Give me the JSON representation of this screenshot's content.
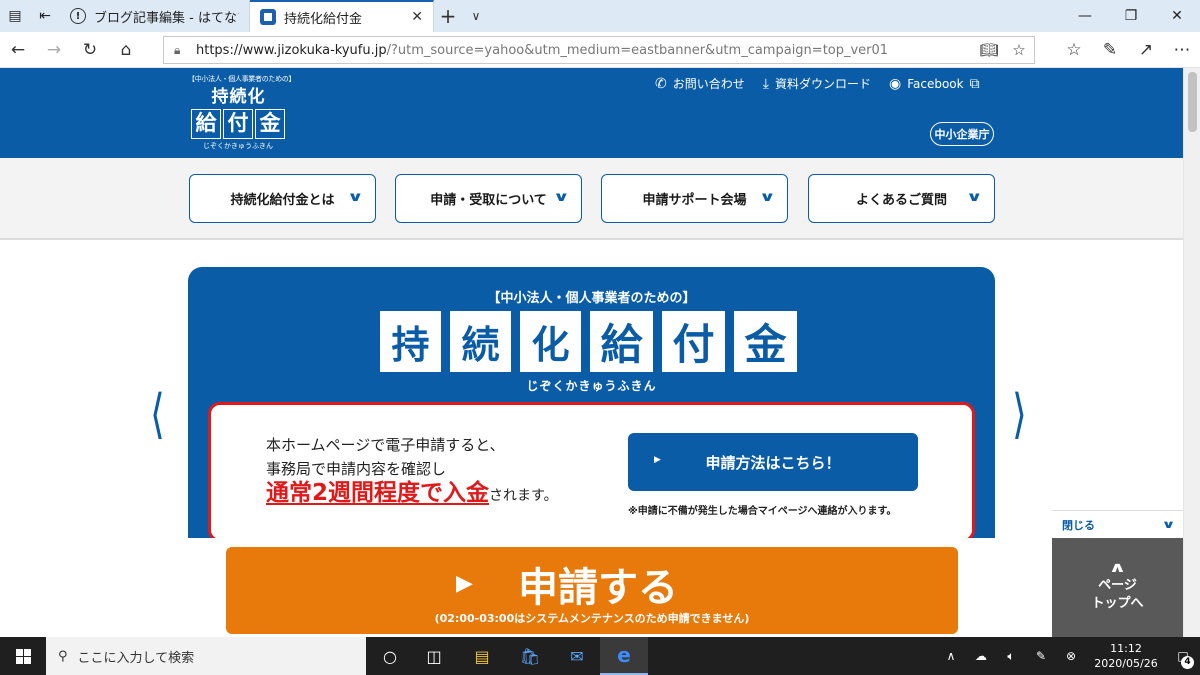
{
  "browser": {
    "tabs": [
      {
        "title": "ブログ記事編集 - はてなブログ",
        "active": false
      },
      {
        "title": "持続化給付金",
        "active": true
      }
    ],
    "url_host": "https://www.jizokuka-kyufu.jp",
    "url_rest": "/?utm_source=yahoo&utm_medium=eastbanner&utm_campaign=top_ver01",
    "accent_color": "#1c5fb0"
  },
  "site": {
    "logo": {
      "sub": "【中小法人・個人事業者のための】",
      "line1": [
        "持",
        "続",
        "化"
      ],
      "line2": [
        "給",
        "付",
        "金"
      ],
      "ruby": "じぞくかきゅうふきん"
    },
    "header_links": {
      "contact": "お問い合わせ",
      "download": "資料ダウンロード",
      "facebook": "Facebook"
    },
    "agency": "中小企業庁",
    "nav": [
      {
        "label": "持続化給付金とは"
      },
      {
        "label": "申請・受取について"
      },
      {
        "label": "申請サポート会場"
      },
      {
        "label": "よくあるご質問"
      }
    ],
    "brand_color": "#0a5ca6",
    "accent_red": "#e01a1a",
    "accent_orange": "#e8790b"
  },
  "hero": {
    "sub": "【中小法人・個人事業者のための】",
    "title_chars": [
      "持",
      "続",
      "化",
      "給",
      "付",
      "金"
    ],
    "ruby": "じぞくかきゅうふきん",
    "message_line1": "本ホームページで電子申請すると、",
    "message_line2": "事務局で申請内容を確認し",
    "message_emphasis": "通常2週間程度で入金",
    "message_tail": "されます。",
    "button_label": "申請方法はこちら！",
    "note": "※申請に不備が発生した場合マイページへ連絡が入ります。"
  },
  "bottom": {
    "apply_label": "申請する",
    "apply_note": "(02:00-03:00はシステムメンテナンスのため申請できません)",
    "close_label": "閉じる",
    "page_top_line1": "ページ",
    "page_top_line2": "トップへ"
  },
  "taskbar": {
    "search_placeholder": "ここに入力して検索",
    "time": "11:12",
    "date": "2020/05/26",
    "notification_count": "4"
  }
}
